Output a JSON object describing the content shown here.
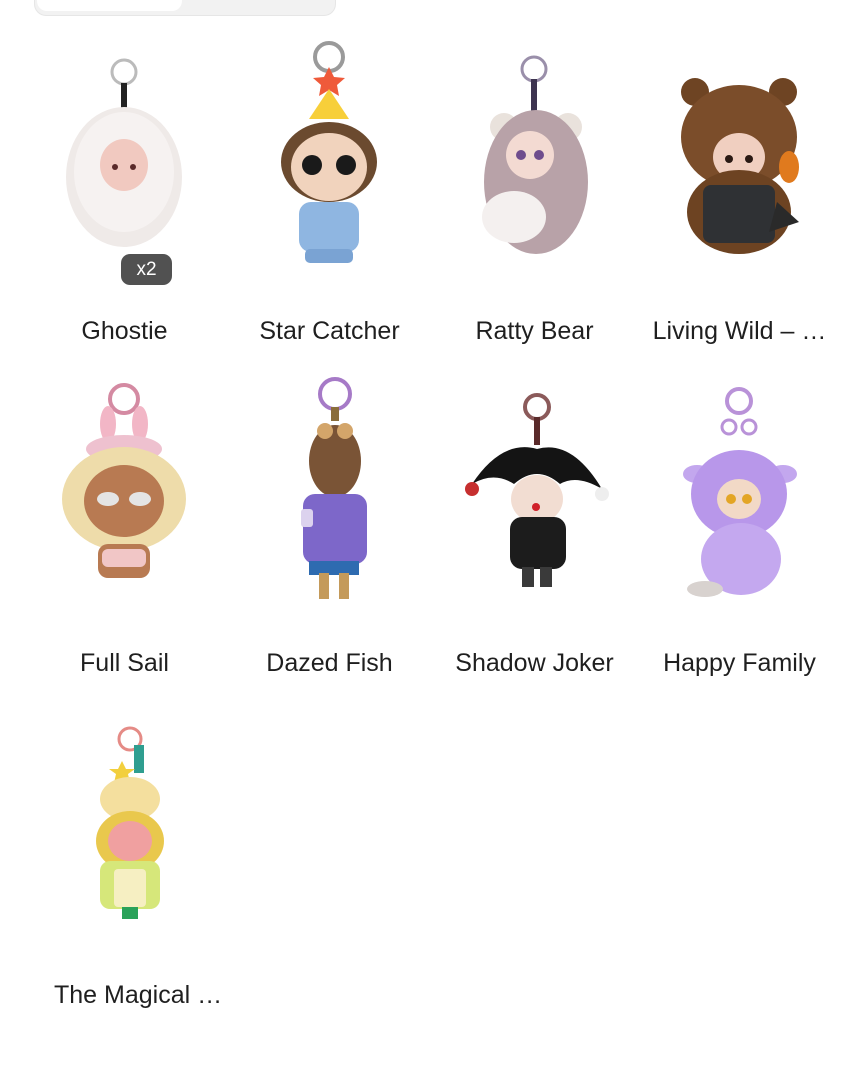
{
  "tabs": {
    "visible": true
  },
  "products": [
    {
      "name": "Ghostie",
      "badge": "x2",
      "icon": "ghostie-figure-icon"
    },
    {
      "name": "Star Catcher",
      "icon": "star-catcher-figure-icon"
    },
    {
      "name": "Ratty Bear",
      "icon": "ratty-bear-figure-icon"
    },
    {
      "name": "Living Wild – …",
      "icon": "living-wild-figure-icon"
    },
    {
      "name": "Full Sail",
      "icon": "full-sail-figure-icon"
    },
    {
      "name": "Dazed Fish",
      "icon": "dazed-fish-figure-icon"
    },
    {
      "name": "Shadow Joker",
      "icon": "shadow-joker-figure-icon"
    },
    {
      "name": "Happy Family",
      "icon": "happy-family-figure-icon"
    },
    {
      "name": "The Magical …",
      "icon": "magical-figure-icon"
    }
  ],
  "colors": {
    "text": "#1f1f1f",
    "badge_bg": "#323232"
  }
}
